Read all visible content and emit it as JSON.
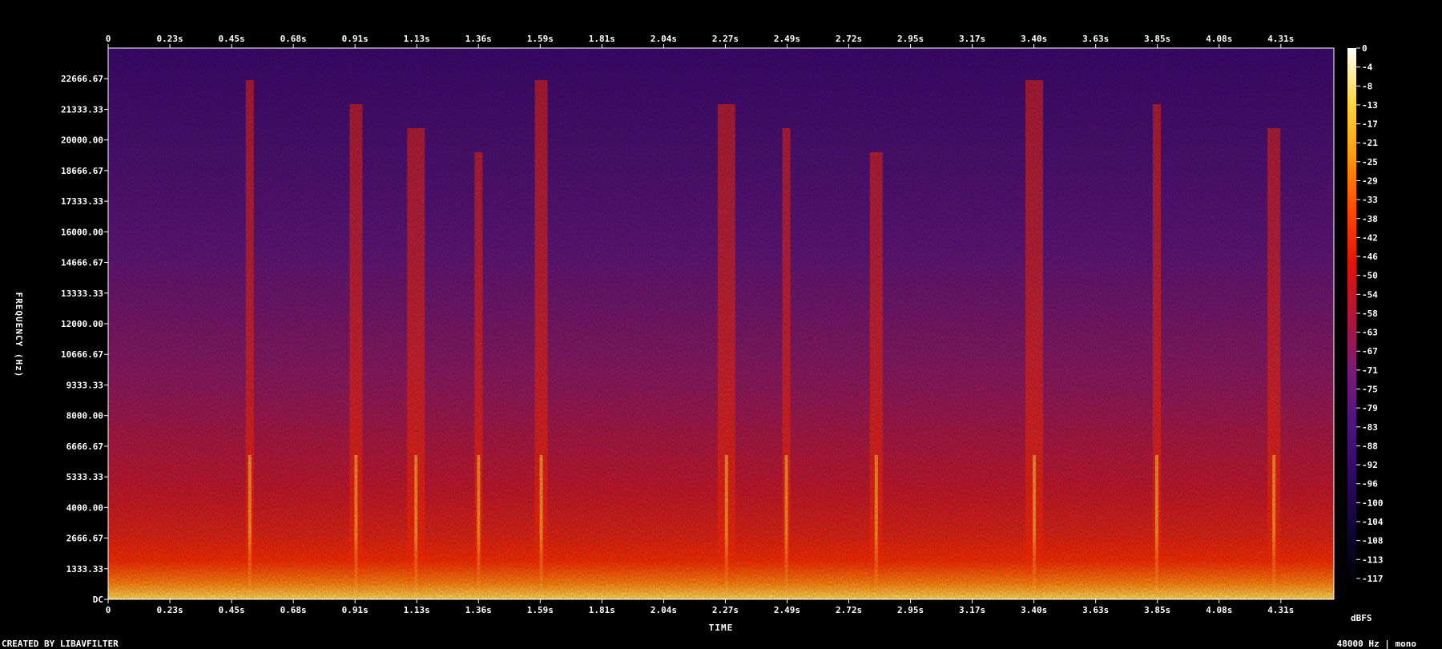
{
  "chart_data": {
    "type": "heatmap",
    "xlabel": "TIME",
    "ylabel": "FREQUENCY (Hz)",
    "x_ticks": [
      "0",
      "0.23s",
      "0.45s",
      "0.68s",
      "0.91s",
      "1.13s",
      "1.36s",
      "1.59s",
      "1.81s",
      "2.04s",
      "2.27s",
      "2.49s",
      "2.72s",
      "2.95s",
      "3.17s",
      "3.40s",
      "3.63s",
      "3.85s",
      "4.08s",
      "4.31s"
    ],
    "y_ticks": [
      "DC",
      "1333.33",
      "2666.67",
      "4000.00",
      "5333.33",
      "6666.67",
      "8000.00",
      "9333.33",
      "10666.67",
      "12000.00",
      "13333.33",
      "14666.67",
      "16000.00",
      "17333.33",
      "18666.67",
      "20000.00",
      "21333.33",
      "22666.67"
    ],
    "xlim": [
      0,
      4.5
    ],
    "ylim": [
      0,
      24000
    ],
    "colorbar": {
      "label": "dBFS",
      "ticks": [
        "0",
        "-4",
        "-8",
        "-13",
        "-17",
        "-21",
        "-25",
        "-29",
        "-33",
        "-38",
        "-42",
        "-46",
        "-50",
        "-54",
        "-58",
        "-63",
        "-67",
        "-71",
        "-75",
        "-79",
        "-83",
        "-88",
        "-92",
        "-96",
        "-100",
        "-104",
        "-108",
        "-113",
        "-117"
      ],
      "range": [
        -120,
        0
      ],
      "colors": [
        "#000000",
        "#0d0630",
        "#2a0a5e",
        "#4e1480",
        "#7a1a78",
        "#b0153a",
        "#e0140a",
        "#ff4a00",
        "#ff9a10",
        "#ffd840",
        "#ffffff"
      ]
    },
    "bright_onsets_s": [
      0.52,
      0.91,
      1.13,
      1.36,
      1.59,
      2.27,
      2.49,
      2.82,
      3.4,
      3.85,
      4.28
    ],
    "legend": "right colorbar"
  },
  "footer": {
    "credit": "CREATED BY LIBAVFILTER",
    "info": "48000 Hz | mono"
  }
}
